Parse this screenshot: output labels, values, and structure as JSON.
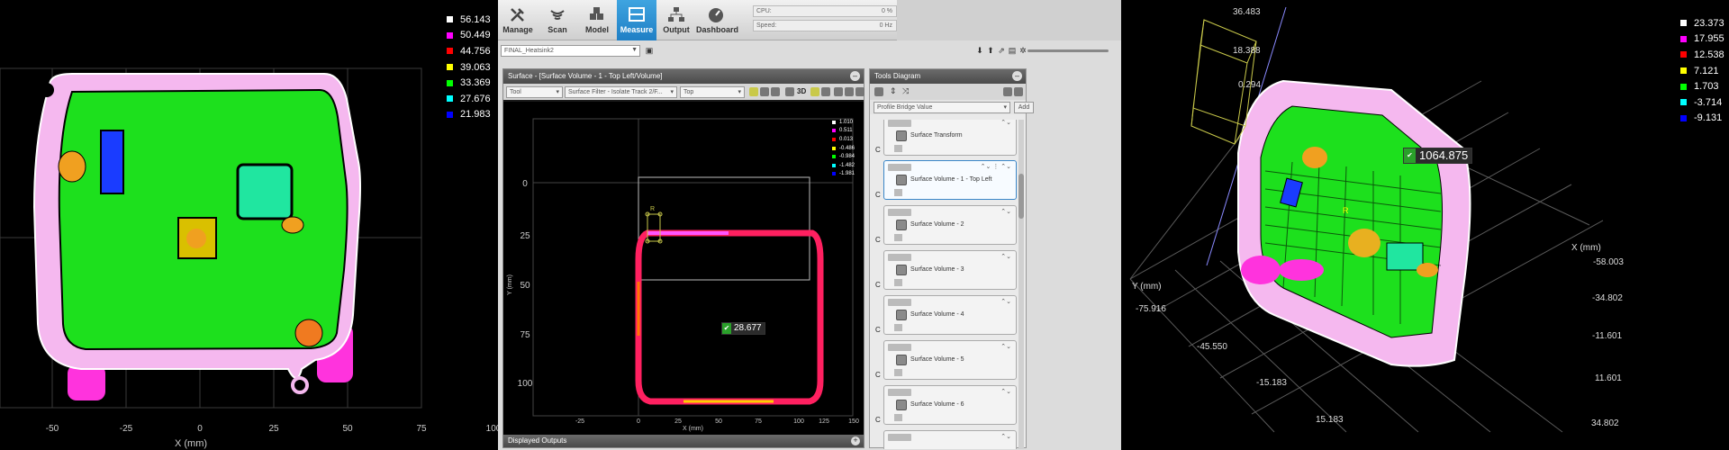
{
  "left_view": {
    "legend": [
      {
        "value": "56.143",
        "color": "#ffffff"
      },
      {
        "value": "50.449",
        "color": "#ff00ff"
      },
      {
        "value": "44.756",
        "color": "#ff0000"
      },
      {
        "value": "39.063",
        "color": "#ffff00"
      },
      {
        "value": "33.369",
        "color": "#00ff00"
      },
      {
        "value": "27.676",
        "color": "#00ffff"
      },
      {
        "value": "21.983",
        "color": "#0000ff"
      }
    ],
    "x_ticks": [
      "-50",
      "-25",
      "0",
      "25",
      "50",
      "75",
      "100"
    ],
    "x_axis_label": "X (mm)"
  },
  "toolbar": {
    "buttons": [
      {
        "label": "Manage",
        "icon": "wrench-icon"
      },
      {
        "label": "Scan",
        "icon": "scan-icon"
      },
      {
        "label": "Model",
        "icon": "cubes-icon"
      },
      {
        "label": "Measure",
        "icon": "measure-icon",
        "active": true
      },
      {
        "label": "Output",
        "icon": "network-icon"
      },
      {
        "label": "Dashboard",
        "icon": "gauge-icon"
      }
    ],
    "cpu_label": "CPU:",
    "cpu_value": "0 %",
    "speed_label": "Speed:",
    "speed_value": "0 Hz"
  },
  "job": {
    "name": "FINAL_Heatsink2"
  },
  "surface_panel": {
    "title": "Surface - [Surface Volume - 1 - Top Left/Volume]",
    "selects": {
      "tool": "Tool",
      "filter": "Surface Filter - Isolate Track 2/F...",
      "view": "Top"
    },
    "view_3d_label": "3D",
    "legend": [
      {
        "value": "1.010",
        "color": "#ffffff"
      },
      {
        "value": "0.511",
        "color": "#ff00ff"
      },
      {
        "value": "0.013",
        "color": "#ff0000"
      },
      {
        "value": "-0.486",
        "color": "#ffff00"
      },
      {
        "value": "-0.984",
        "color": "#00ff00"
      },
      {
        "value": "-1.482",
        "color": "#00ffff"
      },
      {
        "value": "-1.981",
        "color": "#0000ff"
      }
    ],
    "y_ticks": [
      "0",
      "25",
      "50",
      "75",
      "100"
    ],
    "x_ticks": [
      "-25",
      "0",
      "25",
      "50",
      "75",
      "100",
      "125",
      "150"
    ],
    "x_axis_label": "X (mm)",
    "y_axis_label": "Y (mm)",
    "region_label": "R",
    "measurement": "28.677",
    "displayed_outputs": "Displayed Outputs"
  },
  "tools_panel": {
    "title": "Tools Diagram",
    "add_select": "Profile Bridge Value",
    "add_button": "Add",
    "items": [
      {
        "name": "Surface Transform"
      },
      {
        "name": "Surface Volume - 1 - Top Left"
      },
      {
        "name": "Surface Volume - 2"
      },
      {
        "name": "Surface Volume - 3"
      },
      {
        "name": "Surface Volume - 4"
      },
      {
        "name": "Surface Volume - 5"
      },
      {
        "name": "Surface Volume - 6"
      }
    ],
    "c_label": "C"
  },
  "right_view": {
    "legend": [
      {
        "value": "23.373",
        "color": "#ffffff"
      },
      {
        "value": "17.955",
        "color": "#ff00ff"
      },
      {
        "value": "12.538",
        "color": "#ff0000"
      },
      {
        "value": "7.121",
        "color": "#ffff00"
      },
      {
        "value": "1.703",
        "color": "#00ff00"
      },
      {
        "value": "-3.714",
        "color": "#00ffff"
      },
      {
        "value": "-9.131",
        "color": "#0000ff"
      }
    ],
    "z_ticks": [
      "36.483",
      "18.388",
      "0.294"
    ],
    "y_axis_label": "Y (mm)",
    "x_axis_label": "X (mm)",
    "y_ticks": [
      "-75.916",
      "-45.550",
      "-15.183",
      "15.183"
    ],
    "x_ticks": [
      "-58.003",
      "-34.802",
      "-11.601",
      "11.601",
      "34.802"
    ],
    "region_label": "R",
    "measurement": "1064.875"
  }
}
